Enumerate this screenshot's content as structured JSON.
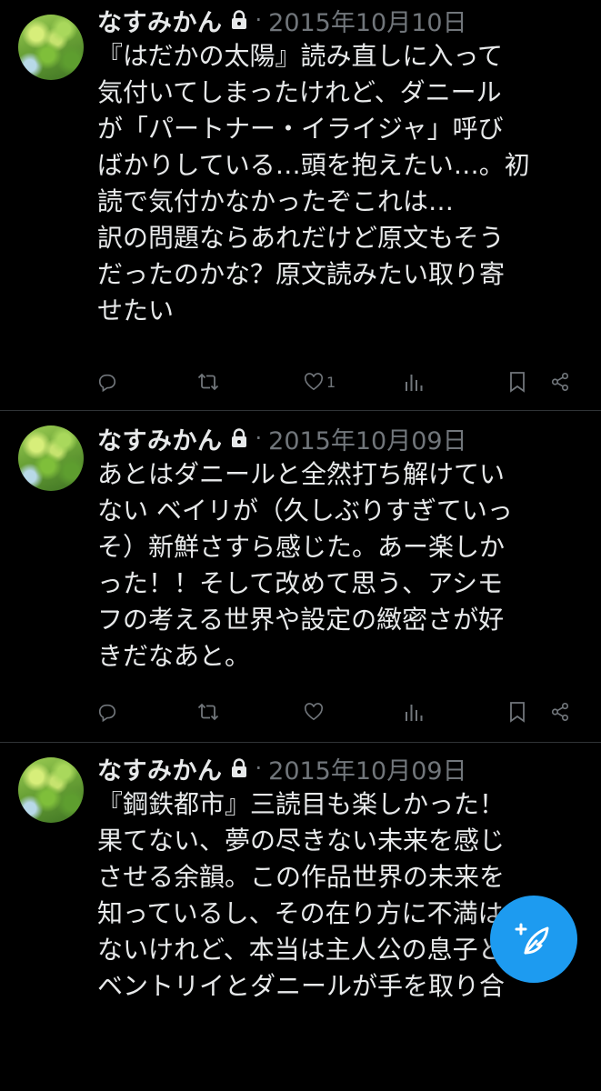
{
  "tweets": [
    {
      "user_name": "なすみかん",
      "separator": "·",
      "date": "2015年10月10日",
      "lines": [
        "『はだかの太陽』読み直しに入って",
        "気付いてしまったけれど、ダニール",
        "が「パートナー・イライジャ」呼び",
        "ばかりしている…頭を抱えたい…。初",
        "読で気付かなかったぞこれは…",
        "訳の問題ならあれだけど原文もそう",
        "だったのかな？原文読みたい取り寄",
        "せたい"
      ],
      "like_count": "1",
      "icons": [
        "reply-icon",
        "retweet-icon",
        "like-icon",
        "views-icon",
        "bookmark-icon",
        "share-icon"
      ]
    },
    {
      "user_name": "なすみかん",
      "separator": "·",
      "date": "2015年10月09日",
      "lines": [
        "あとはダニールと全然打ち解けてい",
        "ない ベイリが（久しぶりすぎていっ",
        "そ）新鮮さすら感じた。あー楽しか",
        "った！！そして改めて思う、アシモ",
        "フの考える世界や設定の緻密さが好",
        "きだなあと。"
      ],
      "like_count": "",
      "icons": [
        "reply-icon",
        "retweet-icon",
        "like-icon",
        "views-icon",
        "bookmark-icon",
        "share-icon"
      ]
    },
    {
      "user_name": "なすみかん",
      "separator": "·",
      "date": "2015年10月09日",
      "lines": [
        "『鋼鉄都市』三読目も楽しかった！",
        "果てない、夢の尽きない未来を感じ",
        "させる余韻。この作品世界の未来を",
        "知っているし、その在り方に不満は",
        "ないけれど、本当は主人公の息子と",
        "ベントリイとダニールが手を取り合"
      ],
      "like_count": "",
      "icons": [
        "reply-icon",
        "retweet-icon",
        "like-icon",
        "views-icon",
        "bookmark-icon",
        "share-icon"
      ]
    }
  ],
  "compose_button": {
    "icon": "compose-feather-icon"
  },
  "colors": {
    "background": "#000000",
    "text": "#e7e9ea",
    "secondary_text": "#71767b",
    "divider": "#2f3336",
    "accent": "#1d9bf0"
  }
}
